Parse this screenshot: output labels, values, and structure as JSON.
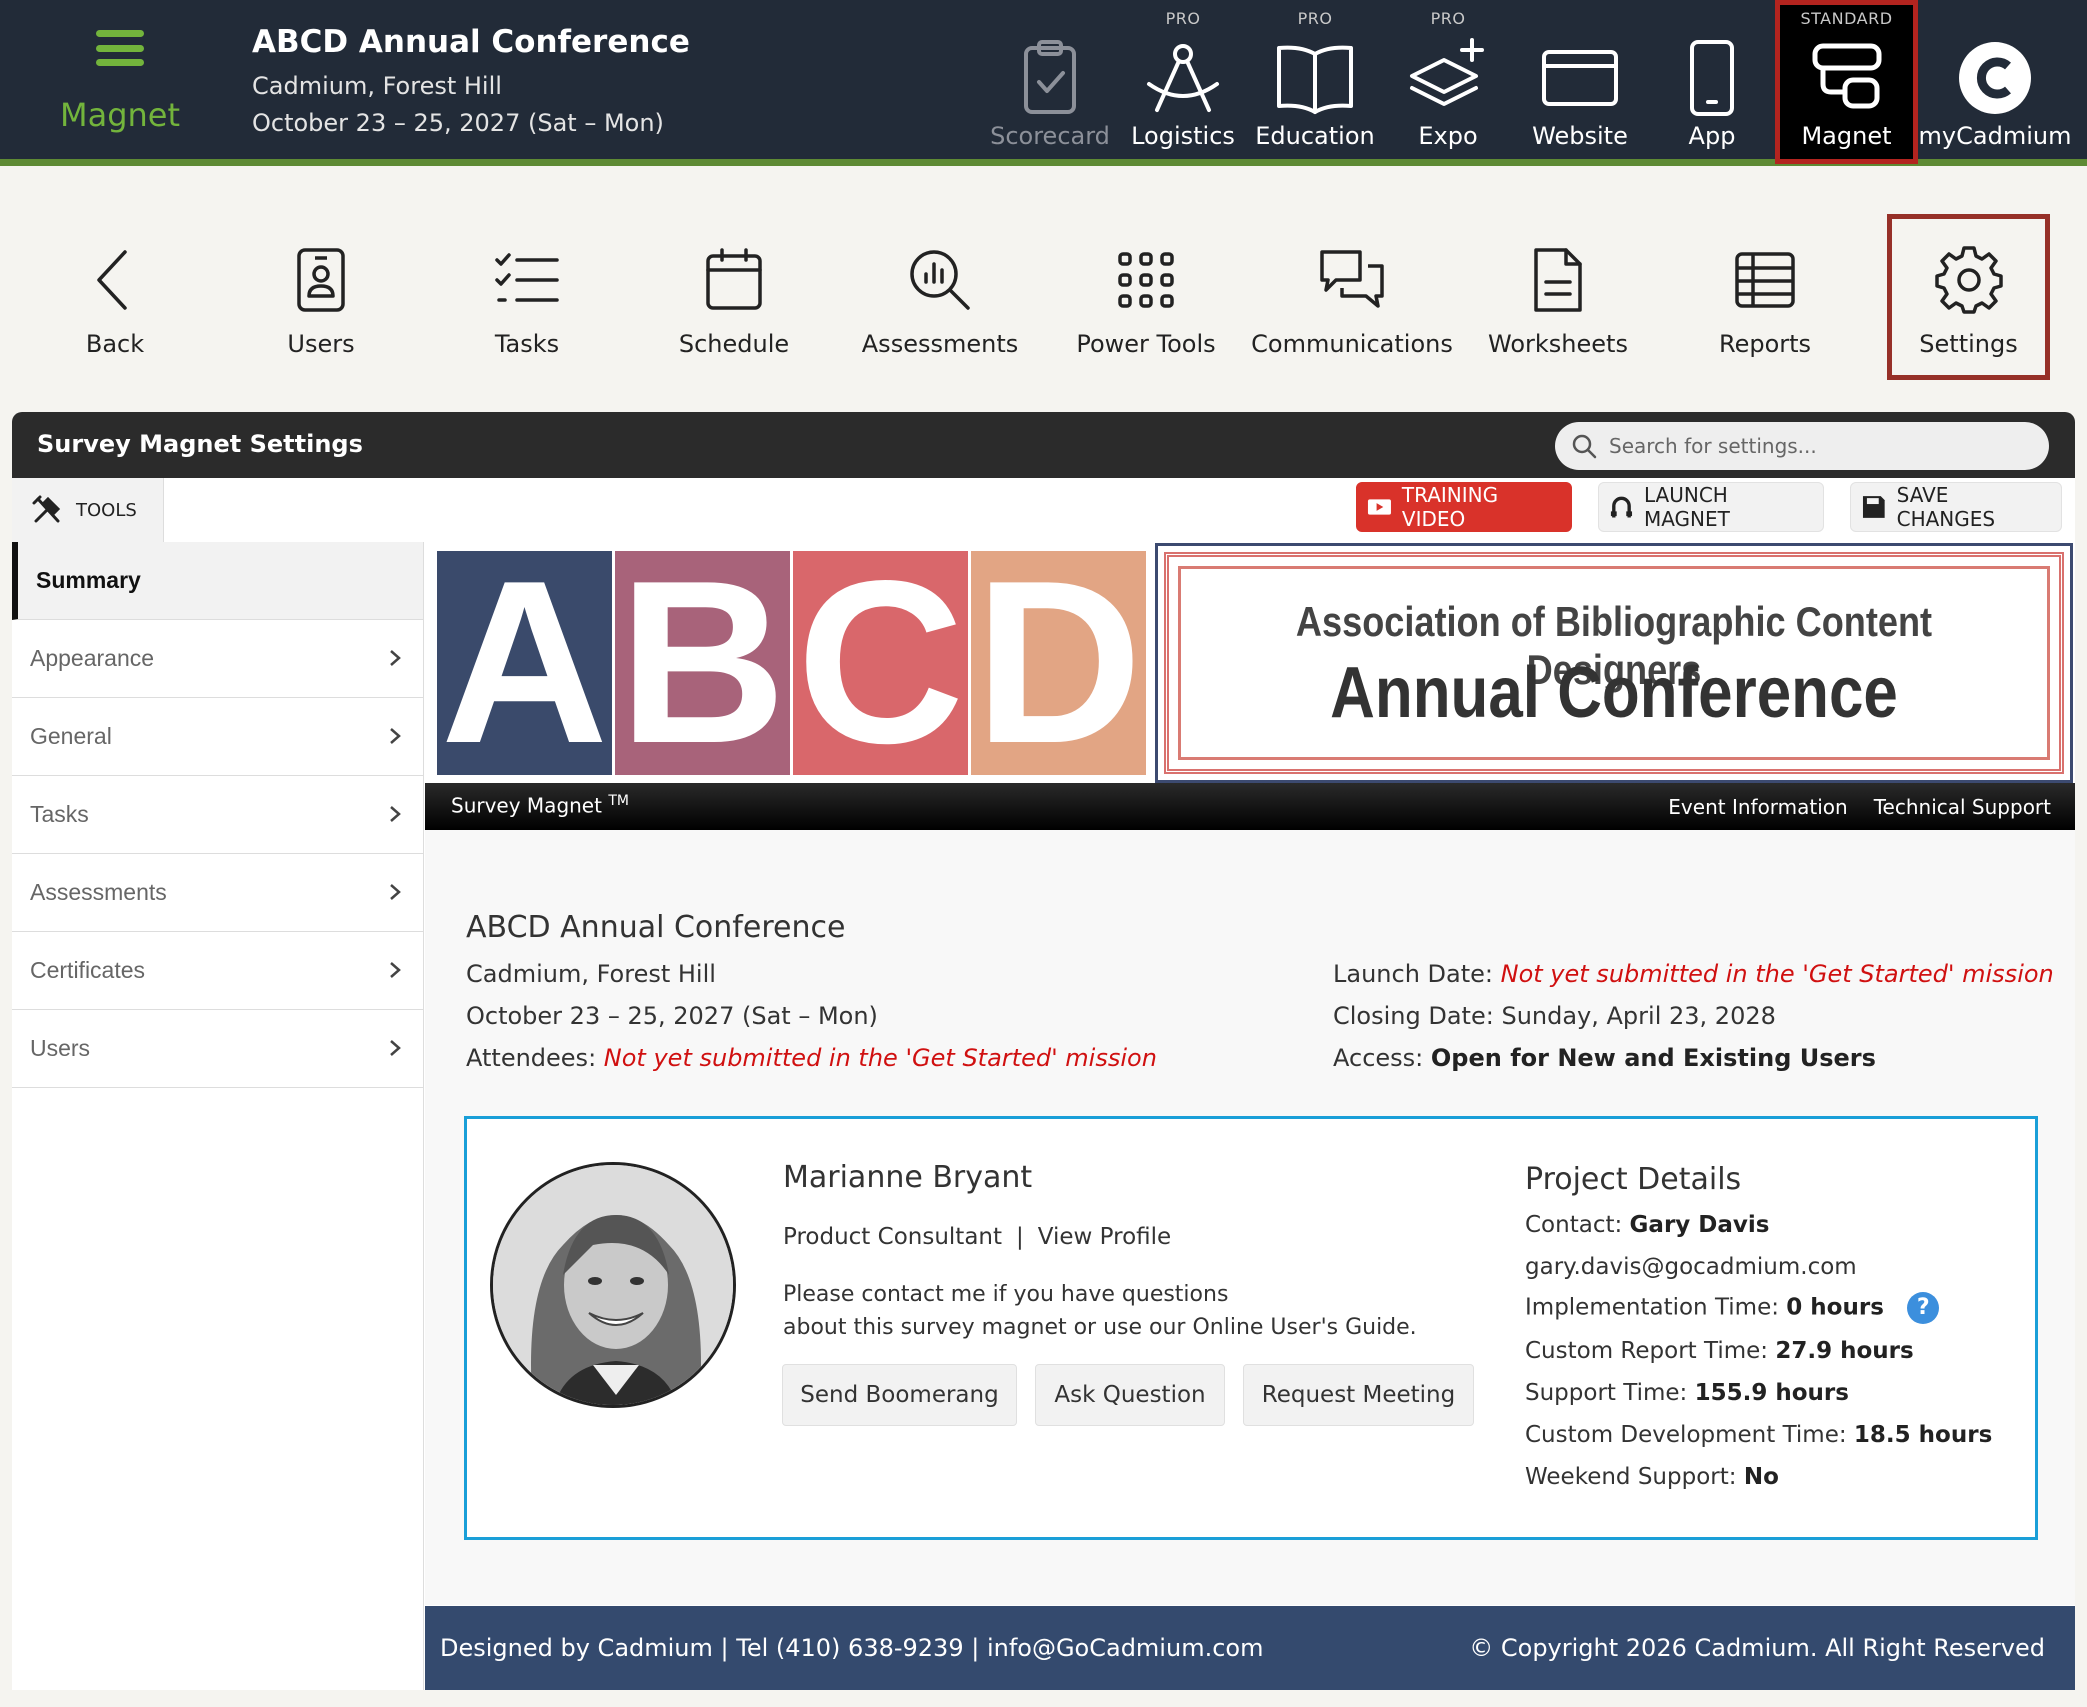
{
  "brand": {
    "name": "Magnet"
  },
  "event": {
    "title": "ABCD Annual Conference",
    "location": "Cadmium, Forest Hill",
    "dates": "October 23 – 25, 2027 (Sat – Mon)"
  },
  "apps": [
    {
      "tier": "",
      "label": "Scorecard",
      "icon": "clipboard-check-icon",
      "state": "disabled"
    },
    {
      "tier": "PRO",
      "label": "Logistics",
      "icon": "compass-icon"
    },
    {
      "tier": "PRO",
      "label": "Education",
      "icon": "open-book-icon"
    },
    {
      "tier": "PRO",
      "label": "Expo",
      "icon": "layers-plus-icon"
    },
    {
      "tier": "",
      "label": "Website",
      "icon": "browser-window-icon"
    },
    {
      "tier": "",
      "label": "App",
      "icon": "smartphone-icon"
    },
    {
      "tier": "STANDARD",
      "label": "Magnet",
      "icon": "magnet-icon",
      "state": "active"
    },
    {
      "tier": "",
      "label": "myCadmium",
      "icon": "cadmium-logo-icon"
    }
  ],
  "toolbar": [
    {
      "label": "Back",
      "icon": "chevron-left-icon"
    },
    {
      "label": "Users",
      "icon": "id-badge-icon"
    },
    {
      "label": "Tasks",
      "icon": "checklist-icon"
    },
    {
      "label": "Schedule",
      "icon": "calendar-icon"
    },
    {
      "label": "Assessments",
      "icon": "chart-magnifier-icon"
    },
    {
      "label": "Power Tools",
      "icon": "grid-dots-icon"
    },
    {
      "label": "Communications",
      "icon": "chat-bubbles-icon"
    },
    {
      "label": "Worksheets",
      "icon": "document-icon"
    },
    {
      "label": "Reports",
      "icon": "table-icon"
    },
    {
      "label": "Settings",
      "icon": "gear-icon",
      "state": "active"
    }
  ],
  "panel": {
    "title": "Survey Magnet Settings",
    "search_placeholder": "Search for settings...",
    "tools_label": "TOOLS",
    "buttons": {
      "training": "TRAINING VIDEO",
      "launch": "LAUNCH MAGNET",
      "save": "SAVE CHANGES"
    }
  },
  "sidebar": {
    "items": [
      {
        "label": "Summary"
      },
      {
        "label": "Appearance"
      },
      {
        "label": "General"
      },
      {
        "label": "Tasks"
      },
      {
        "label": "Assessments"
      },
      {
        "label": "Certificates"
      },
      {
        "label": "Users"
      }
    ]
  },
  "banner": {
    "letters": [
      "A",
      "B",
      "C",
      "D"
    ],
    "org": "Association of Bibliographic Content Designers",
    "conf": "Annual Conference",
    "colors": [
      "#3a4a6b",
      "#a8637a",
      "#d9676b",
      "#e2a584"
    ]
  },
  "survey_bar": {
    "name": "Survey Magnet",
    "tm": "TM",
    "links": [
      "Event Information",
      "Technical Support"
    ]
  },
  "summary": {
    "event_name": "ABCD Annual Conference",
    "location": "Cadmium, Forest Hill",
    "dates": "October 23 – 25, 2027 (Sat – Mon)",
    "attendees_label": "Attendees:",
    "attendees_value": "Not yet submitted in the 'Get Started' mission",
    "launch_label": "Launch Date:",
    "launch_value": "Not yet submitted in the 'Get Started' mission",
    "closing_label": "Closing Date:",
    "closing_value": "Sunday, April 23, 2028",
    "access_label": "Access:",
    "access_value": "Open for New and Existing Users"
  },
  "consultant": {
    "name": "Marianne Bryant",
    "role": "Product Consultant",
    "separator": "|",
    "profile_link": "View Profile",
    "message_l1": "Please contact me if you have questions",
    "message_l2": "about this survey magnet or use our Online User's Guide.",
    "buttons": [
      "Send Boomerang",
      "Ask Question",
      "Request Meeting"
    ]
  },
  "project": {
    "title": "Project Details",
    "contact_label": "Contact:",
    "contact_value": "Gary Davis",
    "email": "gary.davis@gocadmium.com",
    "impl_label": "Implementation Time:",
    "impl_value": "0 hours",
    "help": "?",
    "report_label": "Custom Report Time:",
    "report_value": "27.9 hours",
    "support_label": "Support Time:",
    "support_value": "155.9 hours",
    "dev_label": "Custom Development Time:",
    "dev_value": "18.5 hours",
    "weekend_label": "Weekend Support:",
    "weekend_value": "No"
  },
  "footer": {
    "left": "Designed by Cadmium | Tel (410) 638-9239 | info@GoCadmium.com",
    "right": "© Copyright 2026 Cadmium. All Right Reserved"
  }
}
